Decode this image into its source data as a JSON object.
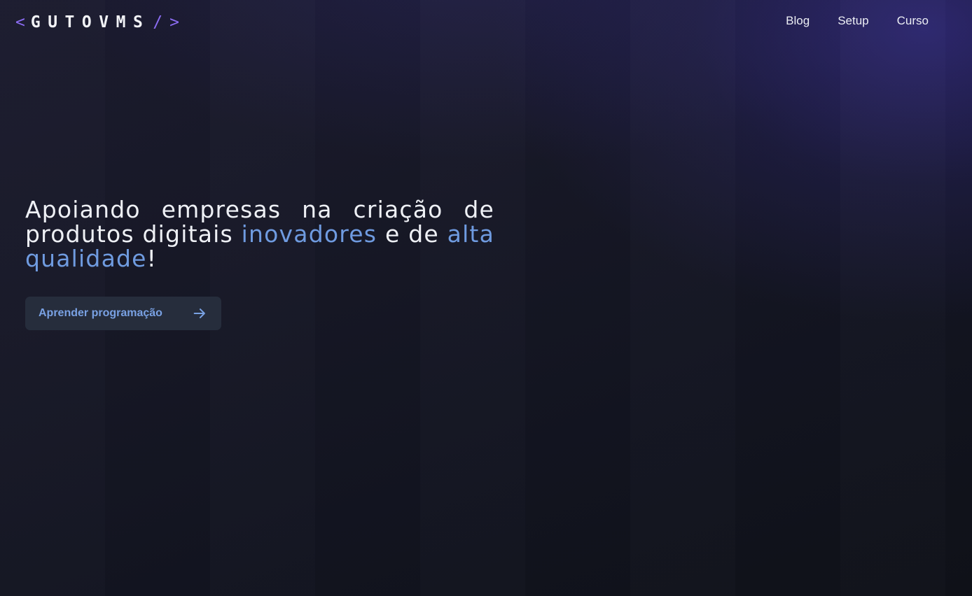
{
  "brand": {
    "open_bracket": "<",
    "name": "GUTOVMS",
    "slash": "/",
    "close_bracket": ">"
  },
  "nav": {
    "items": [
      {
        "label": "Blog"
      },
      {
        "label": "Setup"
      },
      {
        "label": "Curso"
      }
    ]
  },
  "hero": {
    "headline_part1": "Apoiando empresas na criação de produtos digitais ",
    "highlight1": "inovadores",
    "headline_part2": " e de ",
    "highlight2": "alta qualidade",
    "headline_end": "!"
  },
  "cta": {
    "label": "Aprender programação",
    "icon": "arrow-right-icon"
  },
  "colors": {
    "accent_purple": "#8b6cf2",
    "accent_blue": "#6f9be0",
    "button_bg": "#262d3c",
    "text_primary": "#eef0f5"
  }
}
